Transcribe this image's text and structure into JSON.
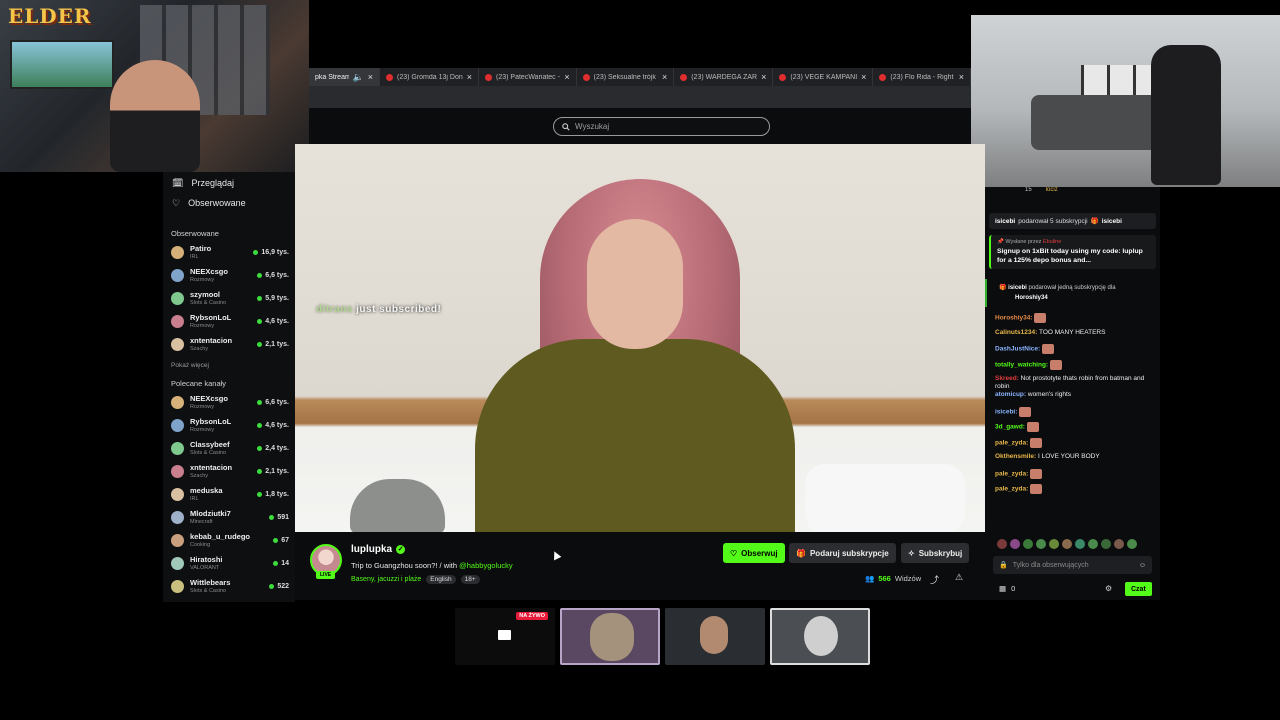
{
  "overlay": {
    "logo_text": "ELDER"
  },
  "tabs": [
    {
      "label": "pka Stream",
      "active": true
    },
    {
      "label": "(23) Gromda 13j Don"
    },
    {
      "label": "(23) PatecWariatec -"
    },
    {
      "label": "(23) Seksualne trójk"
    },
    {
      "label": "(23) WARDEGA ZAR"
    },
    {
      "label": "(23) VEGE KAMPANI"
    },
    {
      "label": "(23) Flo Rida - Right"
    }
  ],
  "search": {
    "placeholder": "Wyszukaj"
  },
  "sidebar": {
    "nav": [
      {
        "label": "Przeglądaj",
        "icon": "browse-icon"
      },
      {
        "label": "Obserwowane",
        "icon": "heart-icon"
      }
    ],
    "followed_heading": "Obserwowane",
    "followed": [
      {
        "name": "Patiro",
        "category": "IRL",
        "viewers": "16,9 tys."
      },
      {
        "name": "NEEXcsgo",
        "category": "Rozmowy",
        "viewers": "6,6 tys."
      },
      {
        "name": "szymool",
        "category": "Slots & Casino",
        "viewers": "5,9 tys."
      },
      {
        "name": "RybsonLoL",
        "category": "Rozmowy",
        "viewers": "4,6 tys."
      },
      {
        "name": "xntentacion",
        "category": "Szachy",
        "viewers": "2,1 tys."
      }
    ],
    "show_more": "Pokaż więcej",
    "recommended_heading": "Polecane kanały",
    "recommended": [
      {
        "name": "NEEXcsgo",
        "category": "Rozmowy",
        "viewers": "6,6 tys."
      },
      {
        "name": "RybsonLoL",
        "category": "Rozmowy",
        "viewers": "4,6 tys."
      },
      {
        "name": "Classybeef",
        "category": "Slots & Casino",
        "viewers": "2,4 tys."
      },
      {
        "name": "xntentacion",
        "category": "Szachy",
        "viewers": "2,1 tys."
      },
      {
        "name": "meduska",
        "category": "IRL",
        "viewers": "1,8 tys."
      },
      {
        "name": "Mlodziutki7",
        "category": "Minecraft",
        "viewers": "591"
      },
      {
        "name": "kebab_u_rudego",
        "category": "Cooking",
        "viewers": "67"
      },
      {
        "name": "Hiratoshi",
        "category": "VALORANT",
        "viewers": "14"
      },
      {
        "name": "Wittlebears",
        "category": "Slots & Casino",
        "viewers": "522"
      }
    ]
  },
  "video": {
    "alert_user": "ditrans",
    "alert_text": "just subscribed!"
  },
  "stream": {
    "name": "luplupka",
    "live_label": "LIVE",
    "title": "Trip to Guangzhou soon?! / with",
    "mention": "@habbygolucky",
    "category": "Baseny, jacuzzi i plaże",
    "tags": [
      "English",
      "18+"
    ],
    "viewers_count": "566",
    "viewers_label": "Widzów"
  },
  "buttons": {
    "follow": "Obserwuj",
    "gift": "Podaruj subskrypcje",
    "subscribe": "Subskrybuj"
  },
  "chat": {
    "top_user": "lociz",
    "top_count": "15",
    "gift_banner_user": "isicebi",
    "gift_banner_text": "podarował 5 subskrypcji",
    "gift_banner_user2": "isicebi",
    "pinned_label": "Wysłane przez",
    "pinned_user": "Ebuline",
    "pinned_msg": "Signup on 1xBit today using my code: luplup for a 125% depo bonus and...",
    "subgift_user": "isicebi",
    "subgift_text": "podarował jedną subskrypcję dla",
    "subgift_target": "Horoshiy34",
    "messages": [
      {
        "user": "Horoshiy34:",
        "text": "",
        "color": "#e58a4a"
      },
      {
        "user": "Calinuts1234:",
        "text": "TOO MANY HEATERS",
        "color": "#e8b84a"
      },
      {
        "user": "DashJustNice:",
        "text": "",
        "color": "#8ab4ff"
      },
      {
        "user": "totally_watching:",
        "text": "",
        "color": "#53fc18"
      },
      {
        "user": "Skreed:",
        "text": "Not prostotyte thats robin from batman and robin",
        "color": "#e03d3d"
      },
      {
        "user": "atomicup:",
        "text": "women's rights",
        "color": "#8ab4ff"
      },
      {
        "user": "isicebi:",
        "text": "",
        "color": "#8ab4ff"
      },
      {
        "user": "3d_gawd:",
        "text": "",
        "color": "#53fc18"
      },
      {
        "user": "pale_zyda:",
        "text": "",
        "color": "#e8b84a"
      },
      {
        "user": "Okthensmile:",
        "text": "I LOVE YOUR BODY",
        "color": "#e8b84a"
      },
      {
        "user": "pale_zyda:",
        "text": "",
        "color": "#e8b84a"
      },
      {
        "user": "pale_zyda:",
        "text": "",
        "color": "#e8b84a"
      }
    ],
    "input_placeholder": "Tylko dla obserwujących",
    "points": "0",
    "send_label": "Czat"
  },
  "thumbs": {
    "live_badge": "NA ŻYWO"
  },
  "colors": {
    "accent": "#53fc18",
    "background": "#0b0c0d"
  }
}
